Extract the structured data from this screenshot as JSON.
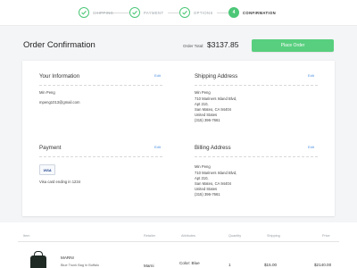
{
  "stepper": {
    "steps": [
      {
        "label": "SHIPPING",
        "state": "done"
      },
      {
        "label": "PAYMENT",
        "state": "done"
      },
      {
        "label": "OPTIONS",
        "state": "done"
      },
      {
        "label": "CONFIRMATION",
        "state": "active",
        "number": "4"
      }
    ]
  },
  "header": {
    "title": "Order Confirmation",
    "total_label": "Order Total:",
    "total_value": "$3137.85",
    "place_order_label": "Place Order"
  },
  "your_info": {
    "title": "Your Information",
    "edit": "Edit",
    "name": "Min Peng",
    "email": "mpeng1013@gmail.com"
  },
  "shipping_address": {
    "title": "Shipping Address",
    "edit": "Edit",
    "name": "Min Peng",
    "line1": "710 Mariners Island Blvd,",
    "line2": "Apt 210,",
    "line3": "San Mateo, CA 94404",
    "country": "United States",
    "phone": "(315) 396-7661"
  },
  "payment": {
    "title": "Payment",
    "edit": "Edit",
    "card_brand": "VISA",
    "card_text": "Visa card ending in 1234"
  },
  "billing_address": {
    "title": "Billing Address",
    "edit": "Edit",
    "name": "Min Peng",
    "line1": "710 Mariners Island Blvd,",
    "line2": "Apt 210,",
    "line3": "San Mateo, CA 94404",
    "country": "United States",
    "phone": "(315) 396-7661"
  },
  "items_table": {
    "headers": [
      "Item",
      "Retailer",
      "Attributes",
      "Quantity",
      "Shipping",
      "Price"
    ],
    "rows": [
      {
        "brand": "MARNI",
        "product": "Blue Trunk Bag In Buffalo",
        "retailer": "Marni",
        "attributes": "Color: Blue",
        "quantity": "1",
        "shipping": "$15.00",
        "price": "$2140.00"
      }
    ]
  },
  "colors": {
    "accent_green": "#58cf7e",
    "link_blue": "#4a90e2",
    "band_gray": "#f4f5f7"
  }
}
